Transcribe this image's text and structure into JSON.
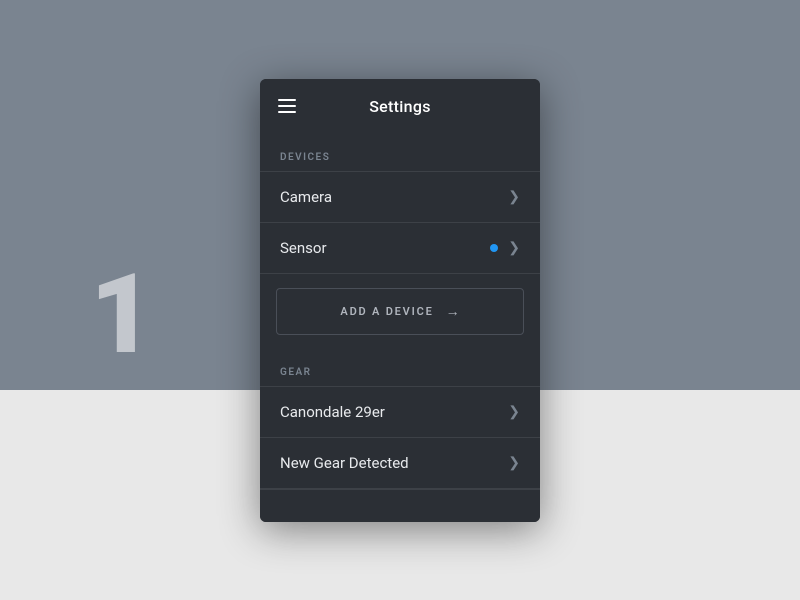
{
  "background": {
    "top_color": "#7a8490",
    "bottom_color": "#e8e8e8"
  },
  "watermark": {
    "text": "1"
  },
  "header": {
    "title": "Settings",
    "hamburger_label": "menu"
  },
  "devices_section": {
    "label": "Devices",
    "items": [
      {
        "id": "camera",
        "label": "Camera",
        "has_dot": false
      },
      {
        "id": "sensor",
        "label": "Sensor",
        "has_dot": true
      }
    ],
    "add_button": {
      "label": "ADD A DEVICE",
      "arrow": "→"
    }
  },
  "gear_section": {
    "label": "Gear",
    "items": [
      {
        "id": "canondale",
        "label": "Canondale 29er",
        "has_dot": false
      },
      {
        "id": "new-gear",
        "label": "New Gear Detected",
        "has_dot": false
      }
    ]
  },
  "icons": {
    "chevron": "❯",
    "arrow": "→"
  }
}
